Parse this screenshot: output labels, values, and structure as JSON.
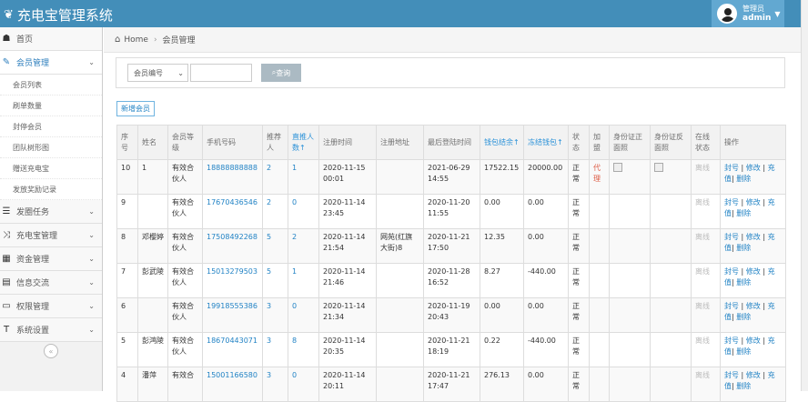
{
  "app": {
    "title": "充电宝管理系统",
    "user_role": "管理员",
    "user_name": "admin"
  },
  "sidebar": {
    "items": [
      {
        "label": "首页",
        "icon": "dashboard-icon"
      },
      {
        "label": "会员管理",
        "icon": "edit-icon",
        "active": true,
        "sub": [
          "会员列表",
          "刷单数量",
          "封停会员",
          "团队树形图",
          "赠送充电宝",
          "发放奖励记录"
        ]
      },
      {
        "label": "发圈任务",
        "icon": "list-icon"
      },
      {
        "label": "充电宝管理",
        "icon": "shuffle-icon"
      },
      {
        "label": "资金管理",
        "icon": "calendar-icon"
      },
      {
        "label": "信息交流",
        "icon": "inbox-icon"
      },
      {
        "label": "权限管理",
        "icon": "lock-icon"
      },
      {
        "label": "系统设置",
        "icon": "text-icon"
      }
    ]
  },
  "breadcrumb": {
    "home": "Home",
    "current": "会员管理"
  },
  "search": {
    "select_value": "会员编号",
    "button": "查询"
  },
  "add_button": "新增会员",
  "table": {
    "headers": [
      "序号",
      "姓名",
      "会员等级",
      "手机号码",
      "推荐人",
      "直推人数↑",
      "注册时间",
      "注册地址",
      "最后登陆时间",
      "钱包结余↑",
      "冻结钱包↑",
      "状态",
      "加盟",
      "身份证正面照",
      "身份证反面照",
      "在线状态",
      "操作"
    ],
    "rows": [
      {
        "id": "10",
        "name": "1",
        "level": "有效合伙人",
        "phone": "18888888888",
        "ref": "2",
        "direct": "1",
        "reg": "2020-11-15 00:01",
        "addr": "",
        "last": "2021-06-29 14:55",
        "wallet": "17522.15",
        "frozen": "20000.00",
        "status": "正常",
        "join": "代理",
        "online": "离线",
        "op1": "封号",
        "op2": "修改",
        "op3": "充值",
        "op4": "删除"
      },
      {
        "id": "9",
        "name": "",
        "level": "有效合伙人",
        "phone": "17670436546",
        "ref": "2",
        "direct": "0",
        "reg": "2020-11-14 23:45",
        "addr": "",
        "last": "2020-11-20 11:55",
        "wallet": "0.00",
        "frozen": "0.00",
        "status": "正常",
        "join": "",
        "online": "离线",
        "op1": "封号",
        "op2": "修改",
        "op3": "充值",
        "op4": "删除"
      },
      {
        "id": "8",
        "name": "邓樱婷",
        "level": "有效合伙人",
        "phone": "17508492268",
        "ref": "5",
        "direct": "2",
        "reg": "2020-11-14 21:54",
        "addr": "网苑(红旗大街)8",
        "last": "2020-11-21 17:50",
        "wallet": "12.35",
        "frozen": "0.00",
        "status": "正常",
        "join": "",
        "online": "离线",
        "op1": "封号",
        "op2": "修改",
        "op3": "充值",
        "op4": "删除"
      },
      {
        "id": "7",
        "name": "彭武陵",
        "level": "有效合伙人",
        "phone": "15013279503",
        "ref": "5",
        "direct": "1",
        "reg": "2020-11-14 21:46",
        "addr": "",
        "last": "2020-11-28 16:52",
        "wallet": "8.27",
        "frozen": "-440.00",
        "status": "正常",
        "join": "",
        "online": "离线",
        "op1": "封号",
        "op2": "修改",
        "op3": "充值",
        "op4": "删除"
      },
      {
        "id": "6",
        "name": "",
        "level": "有效合伙人",
        "phone": "19918555386",
        "ref": "3",
        "direct": "0",
        "reg": "2020-11-14 21:34",
        "addr": "",
        "last": "2020-11-19 20:43",
        "wallet": "0.00",
        "frozen": "0.00",
        "status": "正常",
        "join": "",
        "online": "离线",
        "op1": "封号",
        "op2": "修改",
        "op3": "充值",
        "op4": "删除"
      },
      {
        "id": "5",
        "name": "彭鸿陵",
        "level": "有效合伙人",
        "phone": "18670443071",
        "ref": "3",
        "direct": "8",
        "reg": "2020-11-14 20:35",
        "addr": "",
        "last": "2020-11-21 18:19",
        "wallet": "0.22",
        "frozen": "-440.00",
        "status": "正常",
        "join": "",
        "online": "离线",
        "op1": "封号",
        "op2": "修改",
        "op3": "充值",
        "op4": "删除"
      },
      {
        "id": "4",
        "name": "潘萍",
        "level": "有效合",
        "phone": "15001166580",
        "ref": "3",
        "direct": "0",
        "reg": "2020-11-14 20:11",
        "addr": "",
        "last": "2020-11-21 17:47",
        "wallet": "276.13",
        "frozen": "0.00",
        "status": "正常",
        "join": "",
        "online": "离线",
        "op1": "封号",
        "op2": "修改",
        "op3": "充值",
        "op4": "删除"
      }
    ]
  }
}
